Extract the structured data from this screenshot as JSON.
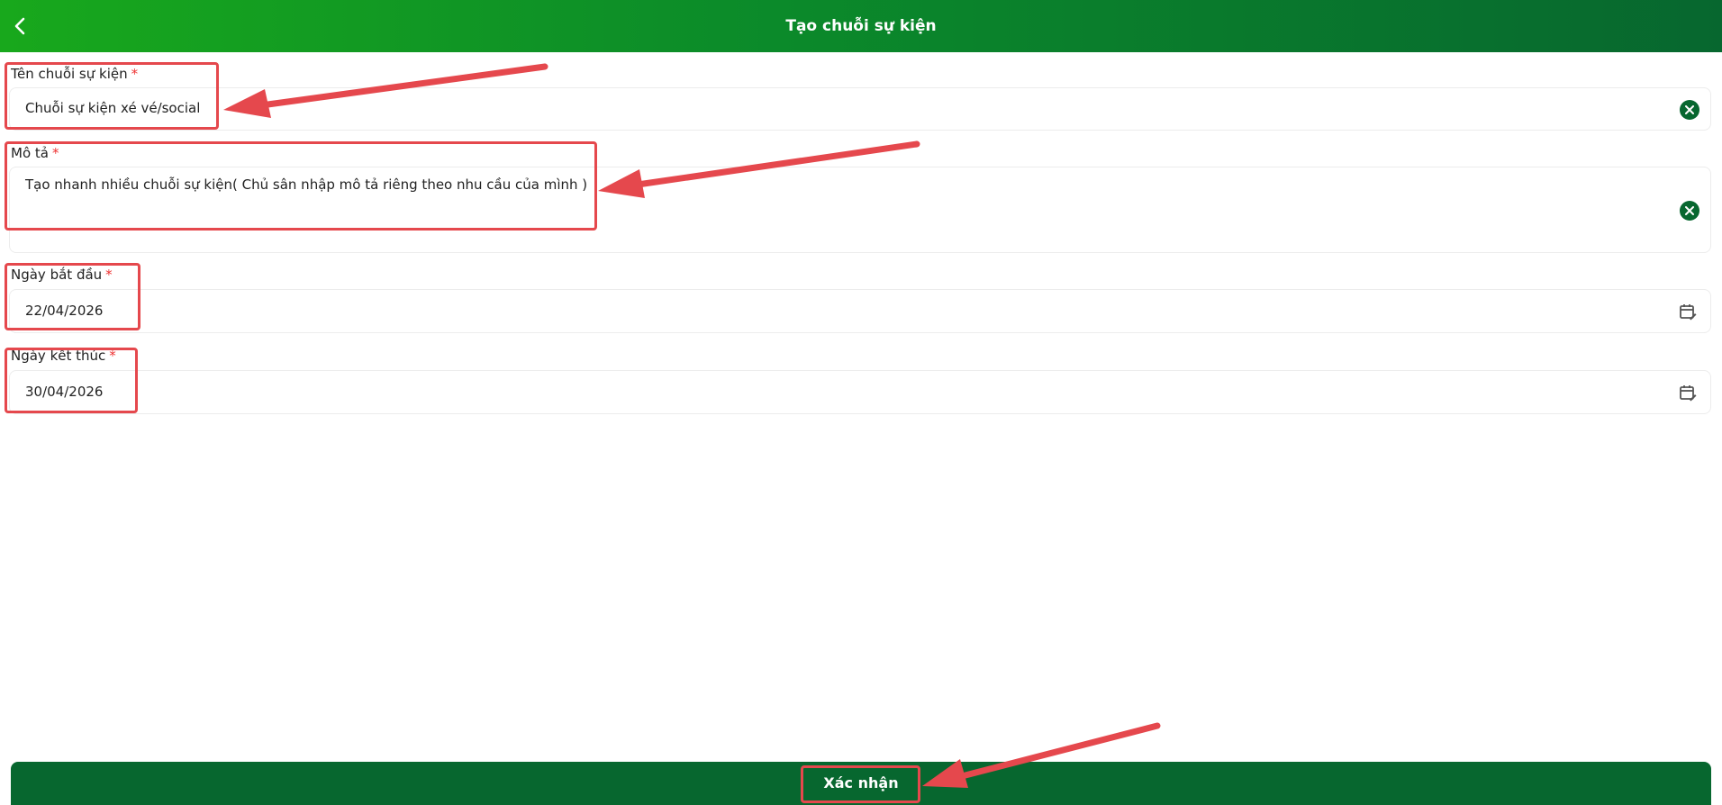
{
  "header": {
    "title": "Tạo chuỗi sự kiện",
    "back_icon": "chevron-left-icon",
    "gradient_colors": [
      "#18a81c",
      "#07672f"
    ]
  },
  "form": {
    "event_name": {
      "label": "Tên chuỗi sự kiện",
      "required_mark": "*",
      "value": "Chuỗi sự kiện xé vé/social",
      "action_icon": "clear-icon"
    },
    "description": {
      "label": "Mô tả",
      "required_mark": "*",
      "value": "Tạo nhanh nhiều chuỗi sự kiện( Chủ sân nhập mô tả riêng theo nhu cầu của mình )",
      "action_icon": "clear-icon"
    },
    "start_date": {
      "label": "Ngày bắt đầu",
      "required_mark": "*",
      "value": "22/04/2026",
      "action_icon": "calendar-edit-icon"
    },
    "end_date": {
      "label": "Ngày kết thúc",
      "required_mark": "*",
      "value": "30/04/2026",
      "action_icon": "calendar-edit-icon"
    }
  },
  "footer": {
    "confirm_label": "Xác nhận",
    "color": "#07672f"
  },
  "annotation_color": "#e5484d"
}
